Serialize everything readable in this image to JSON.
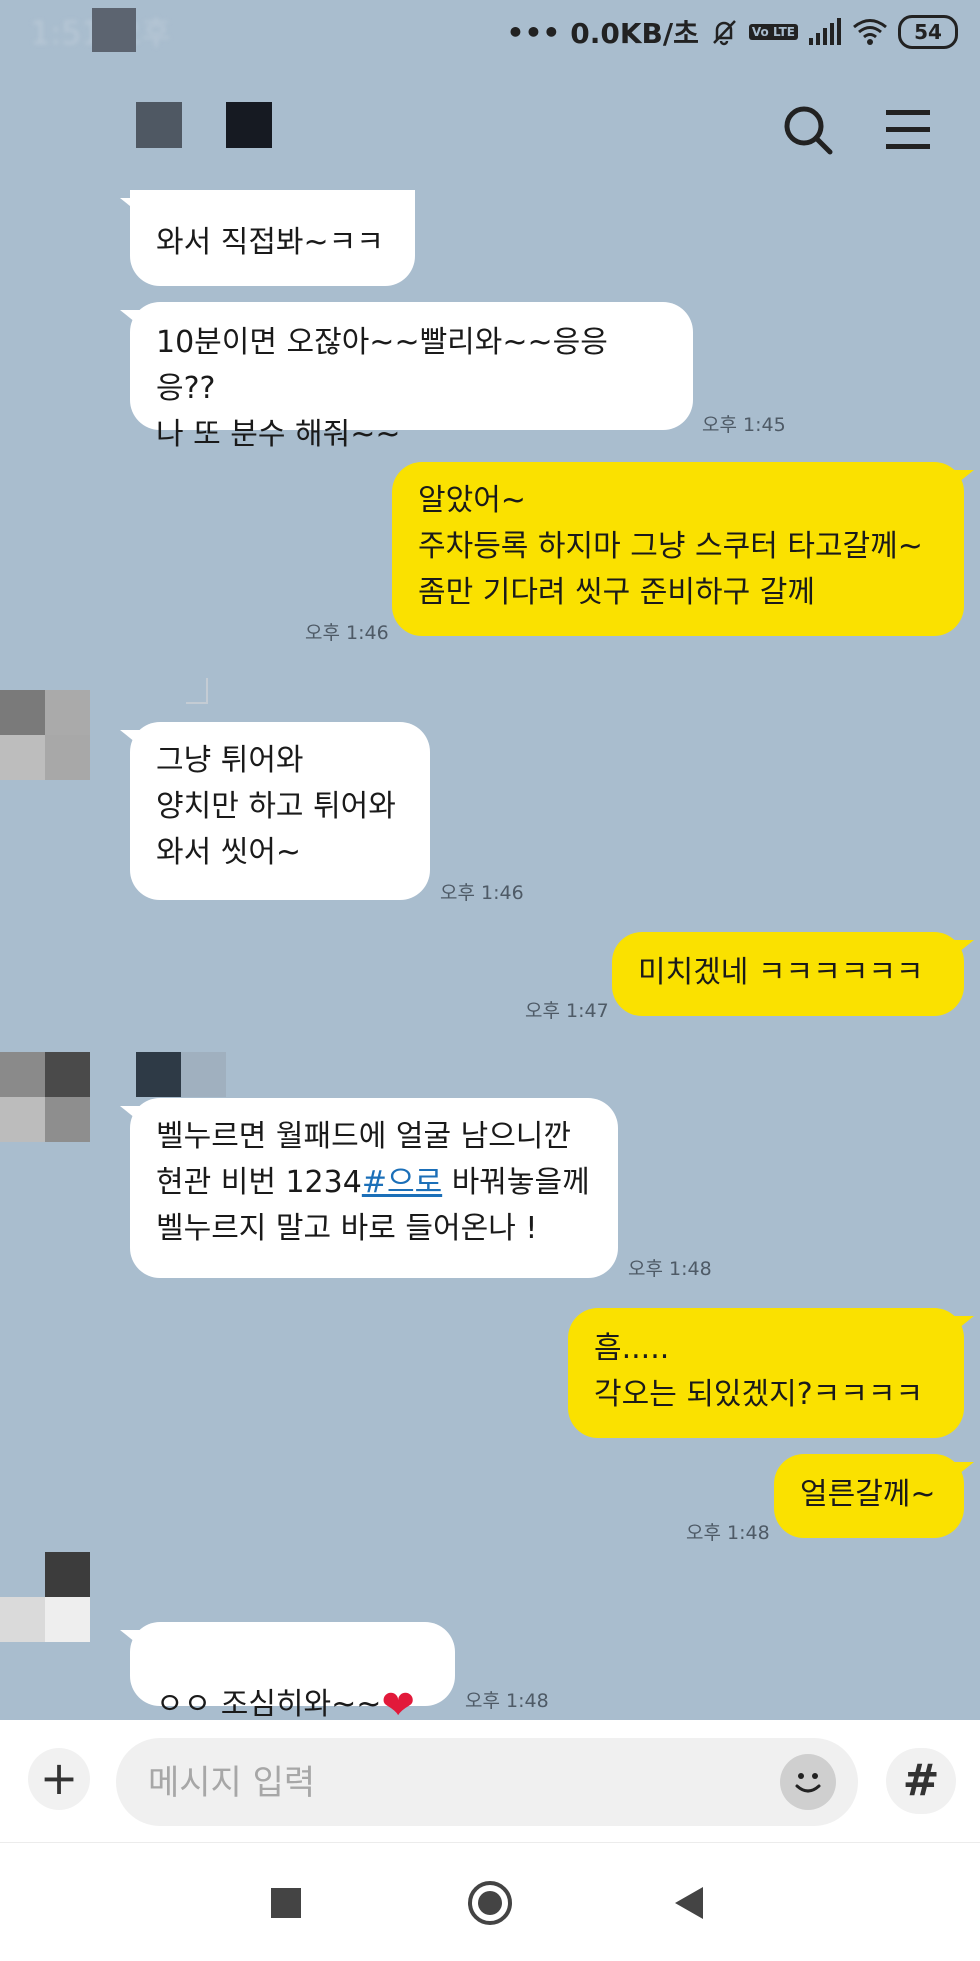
{
  "status_bar": {
    "time": "1:51 오후",
    "network_speed": "0.0KB/초",
    "volte": "Vo LTE",
    "battery": "54"
  },
  "header": {
    "search_icon": "search-icon",
    "menu_icon": "menu-icon"
  },
  "messages": [
    {
      "direction": "in",
      "text": "와서 직접봐~ㅋㅋ"
    },
    {
      "direction": "in",
      "text": "10분이면 오잖아~~빨리와~~응응응??\n나 또 분수 해줘~~",
      "time": "오후 1:45"
    },
    {
      "direction": "out",
      "text": "알았어~\n주차등록 하지마 그냥 스쿠터 타고갈께~\n좀만 기다려 씻구 준비하구 갈께",
      "time": "오후 1:46"
    },
    {
      "direction": "in",
      "text": "그냥 튀어와\n양치만 하고 튀어와\n와서 씻어~",
      "time": "오후 1:46"
    },
    {
      "direction": "out",
      "text": "미치겠네 ㅋㅋㅋㅋㅋㅋ",
      "time": "오후 1:47"
    },
    {
      "direction": "in",
      "text_line1": "벨누르면 월패드에 얼굴 남으니깐",
      "text_line2_prefix": "현관 비번 1234",
      "text_line2_link": "#으로",
      "text_line2_suffix": " 바꿔놓을께",
      "text_line3": "벨누르지 말고 바로 들어온나 !",
      "time": "오후 1:48"
    },
    {
      "direction": "out",
      "text": "흠.....\n각오는 되있겠지?ㅋㅋㅋㅋ"
    },
    {
      "direction": "out",
      "text": "얼른갈께~",
      "time": "오후 1:48"
    },
    {
      "direction": "in",
      "text": "ㅇㅇ 조심히와~~",
      "emoji": "heart",
      "time": "오후 1:48"
    }
  ],
  "input_bar": {
    "placeholder": "메시지 입력",
    "plus_label": "+",
    "hash_label": "#"
  },
  "colors": {
    "background": "#a9bdce",
    "incoming_bubble": "#ffffff",
    "outgoing_bubble": "#fae100",
    "link": "#1b6fb8"
  }
}
